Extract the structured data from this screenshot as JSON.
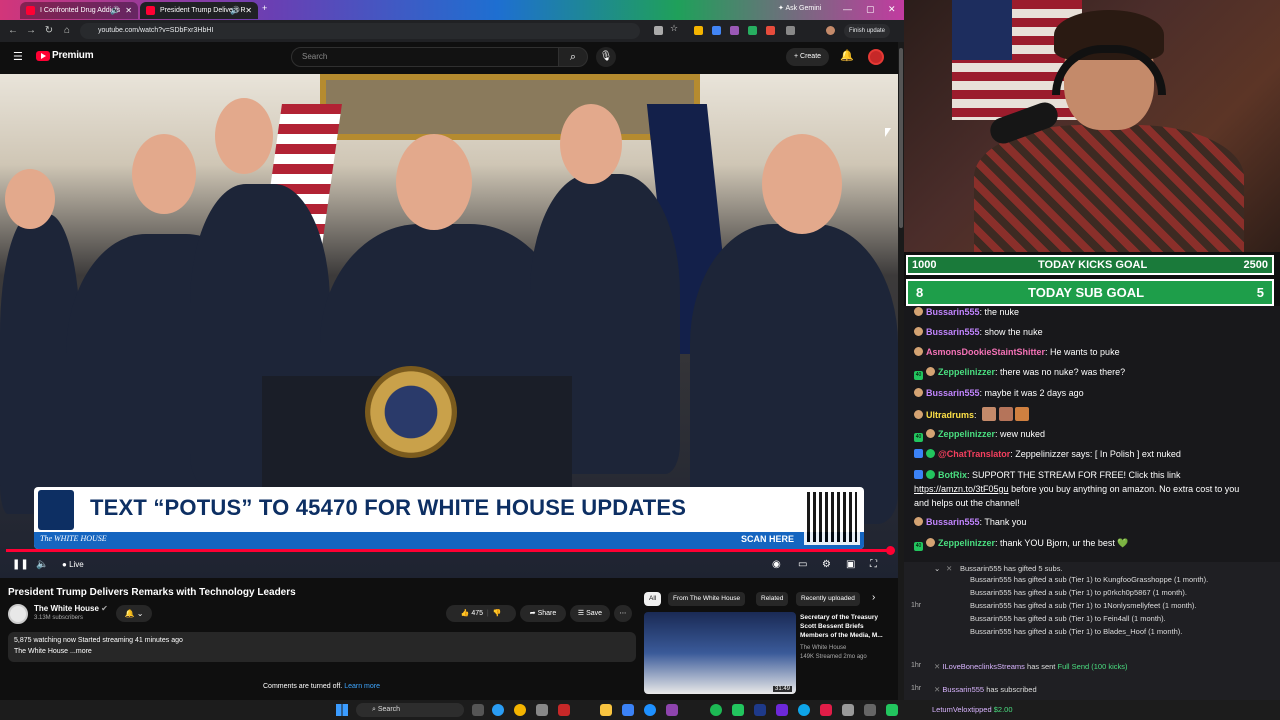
{
  "browser": {
    "tabs": [
      {
        "title": "I Confronted Drug Addicts"
      },
      {
        "title": "President Trump Delivers R"
      }
    ],
    "gemini_label": "Ask Gemini",
    "url": "youtube.com/watch?v=SDbFxr3HbHI",
    "finish_update": "Finish update"
  },
  "youtube": {
    "brand": "Premium",
    "search_placeholder": "Search",
    "create_label": "+ Create",
    "video": {
      "banner_text": "TEXT “POTUS” TO 45470 FOR WHITE HOUSE UPDATES",
      "banner_brand": "The WHITE HOUSE",
      "banner_scan": "SCAN HERE",
      "live_label": "Live"
    },
    "title": "President Trump Delivers Remarks with Technology Leaders",
    "channel": {
      "name": "The White House",
      "subs": "3.13M subscribers"
    },
    "actions": {
      "likes": "475",
      "share": "Share",
      "save": "Save"
    },
    "description": {
      "stats": "5,875 watching now  Started streaming 41 minutes ago",
      "more": "The White House ...more"
    },
    "comments_off": "Comments are turned off.",
    "learn_more": "Learn more",
    "chips": [
      "All",
      "From The White House",
      "Related",
      "Recently uploaded"
    ],
    "related": {
      "title": "Secretary of the Treasury Scott Bessent Briefs Members of the Media, M...",
      "channel": "The White House",
      "meta": "149K  Streamed 2mo ago",
      "duration": "31:49"
    }
  },
  "goals": {
    "kicks": {
      "left": "1000",
      "label": "TODAY KICKS GOAL",
      "right": "2500"
    },
    "subs": {
      "left": "8",
      "label": "TODAY SUB GOAL",
      "right": "5"
    }
  },
  "chat": [
    {
      "user": "Bussarin555",
      "text": ": the nuke",
      "color": "purple"
    },
    {
      "user": "Bussarin555",
      "text": ": show the nuke",
      "color": "purple"
    },
    {
      "user": "AsmonsDookieStaintShitter",
      "text": ": He wants to puke",
      "color": "purple"
    },
    {
      "user": "Zeppelinizzer",
      "text": ": there was no nuke? was there?",
      "color": "green"
    },
    {
      "user": "Bussarin555",
      "text": ": maybe it was 2 days ago",
      "color": "purple"
    },
    {
      "user": "Ultradrums",
      "text": ":",
      "color": "yellow"
    },
    {
      "user": "Zeppelinizzer",
      "text": ": wew nuked",
      "color": "green"
    },
    {
      "user": "@ChatTranslator",
      "text": ": Zeppelinizzer says: [ In Polish ] ext nuked",
      "color": "red"
    },
    {
      "user": "BotRix",
      "text": ": SUPPORT THE STREAM FOR FREE! Click this link",
      "color": "green"
    },
    {
      "user": "",
      "text": "before you buy anything on amazon. No extra cost to you",
      "color": "none"
    },
    {
      "user": "",
      "text": "and helps out the channel!",
      "color": "none"
    },
    {
      "user": "Bussarin555",
      "text": ": Thank you",
      "color": "purple"
    },
    {
      "user": "Zeppelinizzer",
      "text": ": thank YOU Bjorn, ur the best 💚",
      "color": "green"
    }
  ],
  "chat_link": "https://amzn.to/3tF05gu",
  "events": {
    "gift_header": "Bussarin555 has gifted 5 subs.",
    "gift_time": "1hr",
    "gifts": [
      "Bussarin555 has gifted a sub (Tier 1) to KungfooGrasshoppe (1 month).",
      "Bussarin555 has gifted a sub (Tier 1) to p0rkch0p5867 (1 month).",
      "Bussarin555 has gifted a sub (Tier 1) to 1Nonlysmellyfeet (1 month).",
      "Bussarin555 has gifted a sub (Tier 1) to Fein4all (1 month).",
      "Bussarin555 has gifted a sub (Tier 1) to Blades_Hoof (1 month)."
    ],
    "send_user": "ILoveBoneclinksStreams",
    "send_text": "has sent",
    "send_green": "Full Send (100 kicks)",
    "send_time": "1hr",
    "sub_user": "Bussarin555",
    "sub_text": "has subscribed",
    "sub_time": "1hr",
    "tip_user": "LetumVeloxtipped",
    "tip_amount": "$2.00"
  },
  "taskbar": {
    "search": "Search"
  },
  "icons": [
    "menu-icon",
    "search-icon",
    "mic-icon",
    "bell-icon",
    "play-pause-icon",
    "volume-icon",
    "settings-icon",
    "fullscreen-icon",
    "like-icon",
    "dislike-icon",
    "share-icon",
    "save-icon",
    "more-icon",
    "windows-start-icon"
  ]
}
